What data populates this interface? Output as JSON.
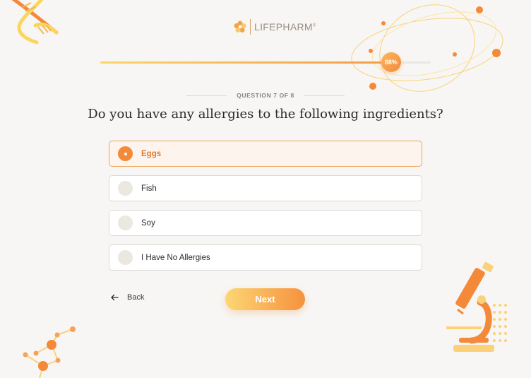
{
  "brand": {
    "name": "LIFEPHARM",
    "mark": "®"
  },
  "progress": {
    "percent": 88,
    "label": "88%"
  },
  "question": {
    "counter": "QUESTION 7 OF 8",
    "text": "Do you have any allergies to the following ingredients?"
  },
  "options": [
    {
      "label": "Eggs",
      "selected": true
    },
    {
      "label": "Fish",
      "selected": false
    },
    {
      "label": "Soy",
      "selected": false
    },
    {
      "label": "I Have No Allergies",
      "selected": false
    }
  ],
  "nav": {
    "back_label": "Back",
    "next_label": "Next"
  },
  "colors": {
    "accent": "#f4893a",
    "accent_light": "#fcd673",
    "background": "#f7f6f4"
  },
  "icons": {
    "back": "arrow-left-icon",
    "logo": "flower-icon"
  }
}
